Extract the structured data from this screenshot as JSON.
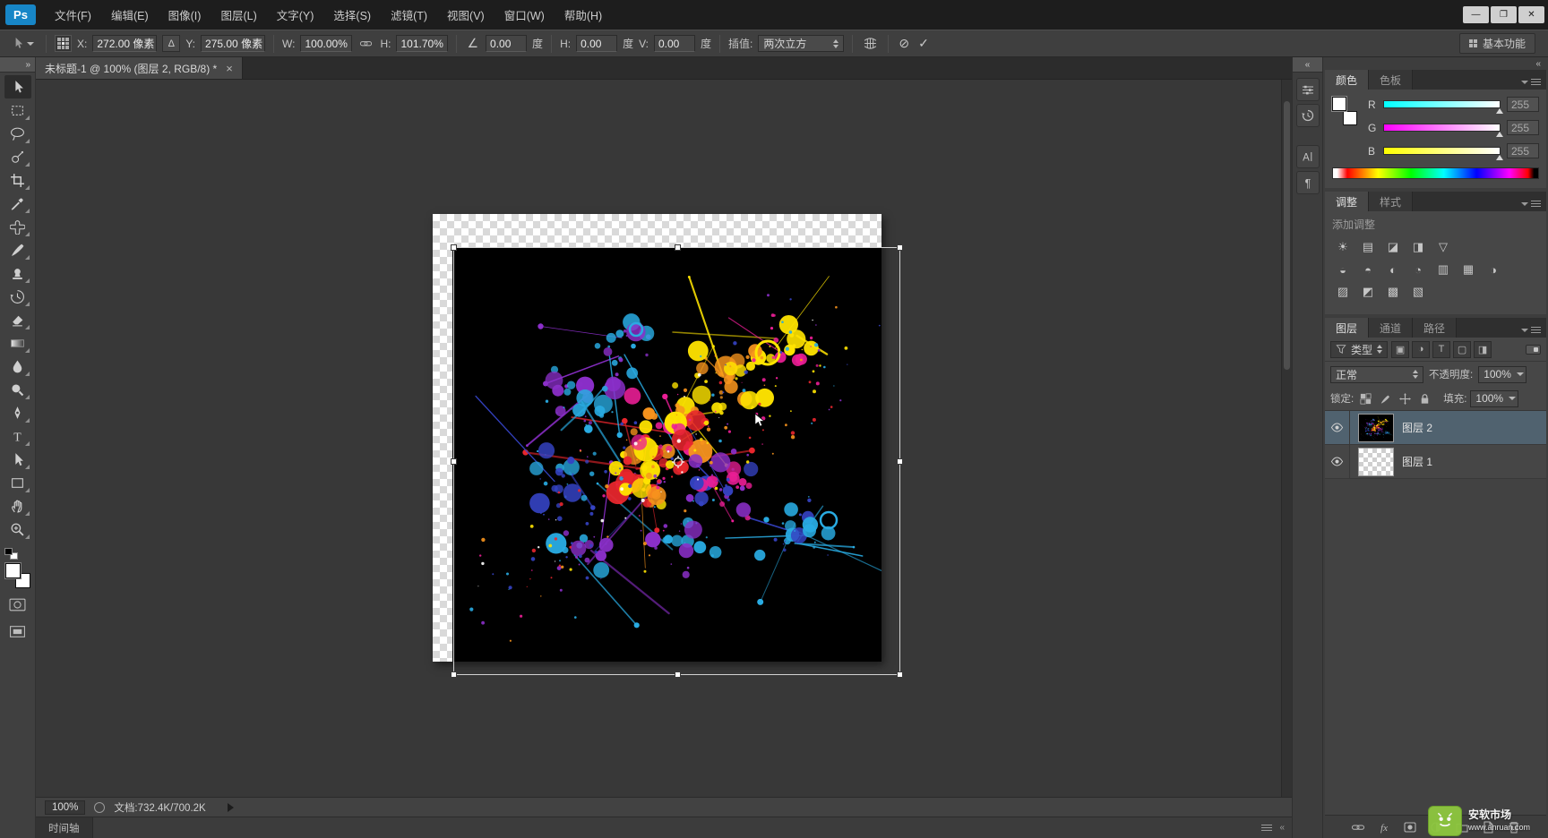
{
  "app": {
    "logo_text": "Ps",
    "window_controls": {
      "minimize": "—",
      "maximize": "❐",
      "close": "✕"
    }
  },
  "menubar": [
    "文件(F)",
    "编辑(E)",
    "图像(I)",
    "图层(L)",
    "文字(Y)",
    "选择(S)",
    "滤镜(T)",
    "视图(V)",
    "窗口(W)",
    "帮助(H)"
  ],
  "options_bar": {
    "x_label": "X:",
    "x_value": "272.00 像素",
    "delta_glyph": "Δ",
    "y_label": "Y:",
    "y_value": "275.00 像素",
    "w_label": "W:",
    "w_value": "100.00%",
    "h_label": "H:",
    "h_value": "101.70%",
    "angle_glyph": "∠",
    "angle_value": "0.00",
    "angle_unit": "度",
    "skew_h_label": "H:",
    "skew_h_value": "0.00",
    "skew_h_unit": "度",
    "skew_v_label": "V:",
    "skew_v_value": "0.00",
    "skew_v_unit": "度",
    "interp_label": "插值:",
    "interp_value": "两次立方",
    "cancel_glyph": "⊘",
    "commit_glyph": "✓",
    "workspace_label": "基本功能"
  },
  "document_tab": {
    "title": "未标题-1 @ 100% (图层 2, RGB/8) *",
    "close_glyph": "×"
  },
  "icons": {
    "collapse_right": "»",
    "collapse_left": "«"
  },
  "toolbar": {
    "tools": [
      "move-tool",
      "rectangular-marquee-tool",
      "lasso-tool",
      "quick-selection-tool",
      "crop-tool",
      "eyedropper-tool",
      "spot-healing-brush-tool",
      "brush-tool",
      "clone-stamp-tool",
      "history-brush-tool",
      "eraser-tool",
      "gradient-tool",
      "blur-tool",
      "dodge-tool",
      "pen-tool",
      "type-tool",
      "path-selection-tool",
      "rectangle-tool",
      "hand-tool",
      "zoom-tool"
    ]
  },
  "color_panel": {
    "tabs": [
      "颜色",
      "色板"
    ],
    "channels": [
      {
        "label": "R",
        "value": "255"
      },
      {
        "label": "G",
        "value": "255"
      },
      {
        "label": "B",
        "value": "255"
      }
    ]
  },
  "adjustments_panel": {
    "tabs": [
      "调整",
      "样式"
    ],
    "hint": "添加调整",
    "rows": [
      [
        {
          "name": "brightness-contrast-icon",
          "glyph": "☀"
        },
        {
          "name": "levels-icon",
          "glyph": "▤"
        },
        {
          "name": "curves-icon",
          "glyph": "◪"
        },
        {
          "name": "exposure-icon",
          "glyph": "◨"
        },
        {
          "name": "vibrance-icon",
          "glyph": "▽"
        }
      ],
      [
        {
          "name": "hue-saturation-icon",
          "glyph": "◒"
        },
        {
          "name": "color-balance-icon",
          "glyph": "◓"
        },
        {
          "name": "black-white-icon",
          "glyph": "◐"
        },
        {
          "name": "photo-filter-icon",
          "glyph": "◔"
        },
        {
          "name": "channel-mixer-icon",
          "glyph": "▥"
        },
        {
          "name": "color-lookup-icon",
          "glyph": "▦"
        },
        {
          "name": "invert-icon",
          "glyph": "◑"
        }
      ],
      [
        {
          "name": "posterize-icon",
          "glyph": "▨"
        },
        {
          "name": "threshold-icon",
          "glyph": "◩"
        },
        {
          "name": "gradient-map-icon",
          "glyph": "▩"
        },
        {
          "name": "selective-color-icon",
          "glyph": "▧"
        }
      ]
    ]
  },
  "layers_panel": {
    "tabs": [
      "图层",
      "通道",
      "路径"
    ],
    "filter_label": "类型",
    "filter_icons": [
      {
        "name": "filter-pixel-layers-icon",
        "glyph": "▣"
      },
      {
        "name": "filter-adjustment-layers-icon",
        "glyph": "◑"
      },
      {
        "name": "filter-type-layers-icon",
        "glyph": "T"
      },
      {
        "name": "filter-shape-layers-icon",
        "glyph": "▢"
      },
      {
        "name": "filter-smart-objects-icon",
        "glyph": "◨"
      }
    ],
    "blend_mode": "正常",
    "opacity_label": "不透明度:",
    "opacity_value": "100%",
    "lock_label": "锁定:",
    "lock_icons": [
      "lock-transparency-icon",
      "lock-pixels-icon",
      "lock-position-icon",
      "lock-all-icon"
    ],
    "fill_label": "填充:",
    "fill_value": "100%",
    "layers": [
      {
        "name": "图层 2",
        "selected": true
      },
      {
        "name": "图层 1",
        "selected": false
      }
    ],
    "footer_icons": [
      "link-layers-icon",
      "layer-style-icon",
      "layer-mask-icon",
      "adjustment-layer-icon",
      "new-group-icon",
      "new-layer-icon",
      "delete-layer-icon"
    ]
  },
  "right_strip_icons": [
    "properties-panel-icon",
    "history-panel-icon",
    "character-panel-icon",
    "paragraph-panel-icon"
  ],
  "status_bar": {
    "zoom": "100%",
    "doc_label": "文档:732.4K/700.2K"
  },
  "timeline": {
    "label": "时间轴"
  },
  "watermark": {
    "line1": "安软市场",
    "line2": "www.anruan.com"
  },
  "artwork": {
    "background": "#000000",
    "colors": [
      "#29abe2",
      "#8b2fc9",
      "#ec1e96",
      "#f7941d",
      "#ffe400",
      "#e8262d",
      "#3543c4",
      "#ffffff"
    ]
  }
}
